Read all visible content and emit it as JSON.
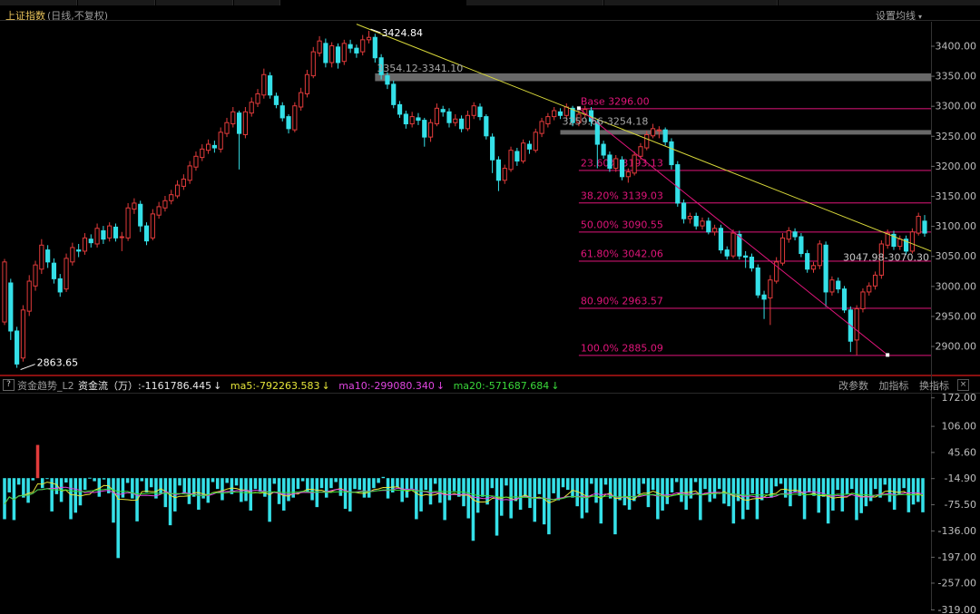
{
  "header": {
    "index_name": "上证指数",
    "mode": "(日线,不复权)",
    "ma_setting": "设置均线"
  },
  "colors": {
    "up": "#e23b3b",
    "down": "#35e0e8",
    "fib": "#e0157a",
    "trend": "#d8d83a",
    "zone": "#8c8c8c",
    "ma5": "#e6e63a",
    "ma10": "#e046e0",
    "ma20": "#3ad83a",
    "axis": "#bdbdbd"
  },
  "lower": {
    "help": "?",
    "name": "资金趋势_L2",
    "flow_label": "资金流（万）:-1161786.445",
    "flow_arrow": "↓",
    "ma5_label": "ma5:-792263.583",
    "ma5_arrow": "↓",
    "ma10_label": "ma10:-299080.340",
    "ma10_arrow": "↓",
    "ma20_label": "ma20:-571687.684",
    "ma20_arrow": "↓",
    "btn_params": "改参数",
    "btn_add": "加指标",
    "btn_switch": "换指标",
    "close": "×"
  },
  "chart_data": [
    {
      "type": "candlestick",
      "title": "上证指数 (日线,不复权)",
      "ylim": [
        2860,
        3440
      ],
      "y_ticks": [
        "3400.00",
        "3350.00",
        "3300.00",
        "3250.00",
        "3200.00",
        "3150.00",
        "3100.00",
        "3050.00",
        "3000.00",
        "2950.00",
        "2900.00"
      ],
      "annotations": {
        "high": "3424.84",
        "low": "2863.65",
        "zone1": "3354.12-3341.10",
        "zone2": "3259.66-3254.18",
        "zone3": "3047.98-3070.30"
      },
      "fib_levels": [
        {
          "label": "Base",
          "value_text": "3296.00",
          "value": 3296.0
        },
        {
          "label": "23.60%",
          "value_text": "3193.13",
          "value": 3193.13
        },
        {
          "label": "38.20%",
          "value_text": "3139.03",
          "value": 3139.03
        },
        {
          "label": "50.00%",
          "value_text": "3090.55",
          "value": 3090.55
        },
        {
          "label": "61.80%",
          "value_text": "3042.06",
          "value": 3042.06
        },
        {
          "label": "80.90%",
          "value_text": "2963.57",
          "value": 2963.57
        },
        {
          "label": "100.0%",
          "value_text": "2885.09",
          "value": 2885.09
        }
      ],
      "candles": [
        [
          2940,
          3040,
          3045,
          2935
        ],
        [
          3005,
          2925,
          3012,
          2910
        ],
        [
          2925,
          2870,
          2932,
          2863.65
        ],
        [
          2880,
          2960,
          2968,
          2874
        ],
        [
          2958,
          3008,
          3018,
          2950
        ],
        [
          3000,
          3035,
          3042,
          2992
        ],
        [
          3028,
          3068,
          3078,
          3020
        ],
        [
          3060,
          3040,
          3068,
          3030
        ],
        [
          3038,
          3012,
          3046,
          3004
        ],
        [
          3012,
          2990,
          3020,
          2982
        ],
        [
          2995,
          3046,
          3054,
          2990
        ],
        [
          3040,
          3064,
          3072,
          3034
        ],
        [
          3060,
          3058,
          3070,
          3048
        ],
        [
          3058,
          3080,
          3088,
          3052
        ],
        [
          3078,
          3072,
          3086,
          3064
        ],
        [
          3070,
          3096,
          3104,
          3064
        ],
        [
          3092,
          3078,
          3100,
          3070
        ],
        [
          3080,
          3100,
          3106,
          3074
        ],
        [
          3098,
          3080,
          3104,
          3074
        ],
        [
          3082,
          3082,
          3090,
          3058
        ],
        [
          3080,
          3130,
          3138,
          3075
        ],
        [
          3128,
          3138,
          3146,
          3120
        ],
        [
          3136,
          3100,
          3142,
          3090
        ],
        [
          3100,
          3075,
          3106,
          3068
        ],
        [
          3080,
          3120,
          3128,
          3076
        ],
        [
          3118,
          3132,
          3140,
          3112
        ],
        [
          3130,
          3142,
          3150,
          3124
        ],
        [
          3142,
          3152,
          3160,
          3136
        ],
        [
          3150,
          3168,
          3176,
          3146
        ],
        [
          3166,
          3178,
          3186,
          3160
        ],
        [
          3176,
          3200,
          3208,
          3170
        ],
        [
          3198,
          3216,
          3224,
          3192
        ],
        [
          3214,
          3228,
          3236,
          3208
        ],
        [
          3226,
          3236,
          3244,
          3220
        ],
        [
          3234,
          3230,
          3242,
          3222
        ],
        [
          3228,
          3256,
          3264,
          3222
        ],
        [
          3254,
          3272,
          3280,
          3248
        ],
        [
          3270,
          3290,
          3298,
          3264
        ],
        [
          3288,
          3254,
          3292,
          3194
        ],
        [
          3252,
          3290,
          3298,
          3246
        ],
        [
          3288,
          3306,
          3314,
          3282
        ],
        [
          3304,
          3320,
          3328,
          3298
        ],
        [
          3318,
          3352,
          3362,
          3312
        ],
        [
          3350,
          3318,
          3356,
          3312
        ],
        [
          3316,
          3302,
          3322,
          3296
        ],
        [
          3300,
          3280,
          3306,
          3274
        ],
        [
          3282,
          3262,
          3286,
          3254
        ],
        [
          3260,
          3300,
          3306,
          3256
        ],
        [
          3298,
          3322,
          3330,
          3292
        ],
        [
          3320,
          3352,
          3360,
          3314
        ],
        [
          3350,
          3390,
          3398,
          3346
        ],
        [
          3388,
          3408,
          3416,
          3382
        ],
        [
          3404,
          3372,
          3412,
          3364
        ],
        [
          3372,
          3400,
          3406,
          3364
        ],
        [
          3398,
          3372,
          3404,
          3362
        ],
        [
          3374,
          3404,
          3410,
          3368
        ],
        [
          3402,
          3396,
          3410,
          3388
        ],
        [
          3396,
          3388,
          3402,
          3380
        ],
        [
          3390,
          3410,
          3418,
          3384
        ],
        [
          3410,
          3414,
          3424.84,
          3404
        ],
        [
          3414,
          3380,
          3420,
          3372
        ],
        [
          3380,
          3352,
          3386,
          3344
        ],
        [
          3350,
          3336,
          3356,
          3328
        ],
        [
          3336,
          3302,
          3342,
          3296
        ],
        [
          3302,
          3286,
          3308,
          3280
        ],
        [
          3286,
          3270,
          3292,
          3262
        ],
        [
          3270,
          3282,
          3290,
          3264
        ],
        [
          3280,
          3276,
          3288,
          3268
        ],
        [
          3276,
          3248,
          3280,
          3232
        ],
        [
          3248,
          3272,
          3278,
          3240
        ],
        [
          3270,
          3296,
          3304,
          3266
        ],
        [
          3294,
          3290,
          3300,
          3282
        ],
        [
          3290,
          3272,
          3296,
          3264
        ],
        [
          3272,
          3278,
          3286,
          3266
        ],
        [
          3278,
          3262,
          3284,
          3256
        ],
        [
          3262,
          3284,
          3292,
          3258
        ],
        [
          3284,
          3300,
          3306,
          3278
        ],
        [
          3298,
          3282,
          3304,
          3276
        ],
        [
          3282,
          3250,
          3286,
          3244
        ],
        [
          3248,
          3210,
          3254,
          3188
        ],
        [
          3210,
          3176,
          3216,
          3158
        ],
        [
          3176,
          3196,
          3202,
          3170
        ],
        [
          3194,
          3226,
          3232,
          3190
        ],
        [
          3224,
          3208,
          3230,
          3200
        ],
        [
          3208,
          3238,
          3244,
          3204
        ],
        [
          3236,
          3228,
          3242,
          3220
        ],
        [
          3226,
          3256,
          3262,
          3222
        ],
        [
          3254,
          3274,
          3280,
          3248
        ],
        [
          3270,
          3282,
          3288,
          3264
        ],
        [
          3282,
          3292,
          3298,
          3276
        ],
        [
          3290,
          3284,
          3296,
          3278
        ],
        [
          3284,
          3298,
          3304,
          3278
        ],
        [
          3296,
          3272,
          3300,
          3266
        ],
        [
          3272,
          3286,
          3292,
          3266
        ],
        [
          3286,
          3294,
          3300,
          3280
        ],
        [
          3292,
          3274,
          3298,
          3266
        ],
        [
          3272,
          3236,
          3278,
          3196
        ],
        [
          3236,
          3218,
          3242,
          3212
        ],
        [
          3218,
          3196,
          3224,
          3190
        ],
        [
          3196,
          3212,
          3218,
          3190
        ],
        [
          3210,
          3182,
          3216,
          3176
        ],
        [
          3182,
          3190,
          3196,
          3172
        ],
        [
          3188,
          3218,
          3224,
          3184
        ],
        [
          3216,
          3232,
          3238,
          3210
        ],
        [
          3230,
          3252,
          3258,
          3226
        ],
        [
          3250,
          3262,
          3270,
          3246
        ],
        [
          3260,
          3260,
          3266,
          3246
        ],
        [
          3260,
          3240,
          3264,
          3234
        ],
        [
          3240,
          3202,
          3246,
          3194
        ],
        [
          3202,
          3138,
          3208,
          3132
        ],
        [
          3138,
          3112,
          3144,
          3104
        ],
        [
          3112,
          3116,
          3122,
          3104
        ],
        [
          3116,
          3100,
          3122,
          3094
        ],
        [
          3100,
          3108,
          3114,
          3094
        ],
        [
          3108,
          3090,
          3114,
          3086
        ],
        [
          3090,
          3096,
          3102,
          3084
        ],
        [
          3096,
          3060,
          3102,
          3054
        ],
        [
          3060,
          3050,
          3066,
          3044
        ],
        [
          3050,
          3088,
          3094,
          3046
        ],
        [
          3086,
          3050,
          3092,
          3044
        ],
        [
          3050,
          3048,
          3058,
          3030
        ],
        [
          3048,
          3030,
          3054,
          3024
        ],
        [
          3030,
          2985,
          3036,
          2980
        ],
        [
          2985,
          2978,
          2992,
          2945
        ],
        [
          2980,
          3010,
          3018,
          2935
        ],
        [
          3008,
          3040,
          3048,
          3004
        ],
        [
          3038,
          3080,
          3088,
          3034
        ],
        [
          3078,
          3092,
          3098,
          3072
        ],
        [
          3090,
          3082,
          3096,
          3076
        ],
        [
          3082,
          3054,
          3088,
          3048
        ],
        [
          3054,
          3028,
          3060,
          3022
        ],
        [
          3028,
          3034,
          3040,
          3022
        ],
        [
          3034,
          3070,
          3076,
          3028
        ],
        [
          3068,
          2990,
          3074,
          2965
        ],
        [
          2990,
          3010,
          3016,
          2984
        ],
        [
          3008,
          2995,
          3014,
          2988
        ],
        [
          2995,
          2960,
          3000,
          2955
        ],
        [
          2960,
          2908,
          2966,
          2890
        ],
        [
          2910,
          2962,
          2968,
          2885
        ],
        [
          2962,
          2990,
          2996,
          2956
        ],
        [
          2990,
          3000,
          3006,
          2984
        ],
        [
          3000,
          3018,
          3024,
          2994
        ],
        [
          3018,
          3070,
          3076,
          3012
        ],
        [
          3068,
          3088,
          3094,
          3062
        ],
        [
          3086,
          3066,
          3092,
          3060
        ],
        [
          3066,
          3078,
          3084,
          3060
        ],
        [
          3078,
          3058,
          3084,
          3052
        ],
        [
          3058,
          3090,
          3096,
          3054
        ],
        [
          3088,
          3116,
          3122,
          3084
        ],
        [
          3108,
          3088,
          3118,
          3082
        ]
      ]
    },
    {
      "type": "bar",
      "title": "资金趋势_L2",
      "ylim": [
        -319,
        185
      ],
      "y_ticks": [
        "172.00",
        "106.00",
        "45.60",
        "-14.90",
        "-75.50",
        "-136.00",
        "-197.00",
        "-257.00",
        "-319.00"
      ],
      "series": [
        {
          "name": "资金流（万）",
          "values": [
            -110,
            -48,
            -112,
            -30,
            -60,
            -72,
            -20,
            62,
            -38,
            -15,
            -92,
            -52,
            -70,
            -25,
            -110,
            -95,
            -78,
            -42,
            -14,
            -22,
            -58,
            -18,
            -50,
            -118,
            -200,
            -60,
            -26,
            -62,
            -115,
            -22,
            -48,
            -36,
            -62,
            -52,
            -82,
            -124,
            -92,
            -32,
            -50,
            -75,
            -58,
            -88,
            -62,
            -72,
            -24,
            -40,
            -66,
            -26,
            -52,
            -32,
            -70,
            -68,
            -90,
            -40,
            -46,
            -58,
            -116,
            -28,
            -75,
            -90,
            -68,
            -60,
            -40,
            -22,
            -46,
            -66,
            -82,
            -38,
            -60,
            -38,
            -24,
            -56,
            -86,
            -92,
            -40,
            -42,
            -60,
            -60,
            -38,
            -26,
            -12,
            -62,
            -48,
            -36,
            -70,
            -60,
            -40,
            -110,
            -92,
            -42,
            -76,
            -28,
            -72,
            -112,
            -66,
            -45,
            -58,
            -80,
            -108,
            -160,
            -95,
            -58,
            -76,
            -38,
            -148,
            -102,
            -32,
            -108,
            -68,
            -88,
            -58,
            -84,
            -116,
            -52,
            -122,
            -145,
            -50,
            -66,
            -36,
            -42,
            -60,
            -80,
            -108,
            -95,
            -28,
            -72,
            -120,
            -30,
            -62,
            -145,
            -66,
            -78,
            -88,
            -68,
            -52,
            -28,
            -82,
            -42,
            -110,
            -90,
            -75,
            -48,
            -24,
            -70,
            -88,
            -62,
            -24,
            -112,
            -40,
            -70,
            -62,
            -40,
            -74,
            -80,
            -120,
            -68,
            -110,
            -88,
            -50,
            -110,
            -66,
            -50,
            -60,
            -34,
            -28,
            -60,
            -80,
            -48,
            -56,
            -110,
            -48,
            -56,
            -95,
            -58,
            -120,
            -90,
            -42,
            -92,
            -52,
            -40,
            -112,
            -96,
            -80,
            -68,
            -40,
            -60,
            -30,
            -70,
            -88,
            -52,
            -38,
            -94,
            -76,
            -70,
            -94
          ]
        }
      ]
    }
  ]
}
